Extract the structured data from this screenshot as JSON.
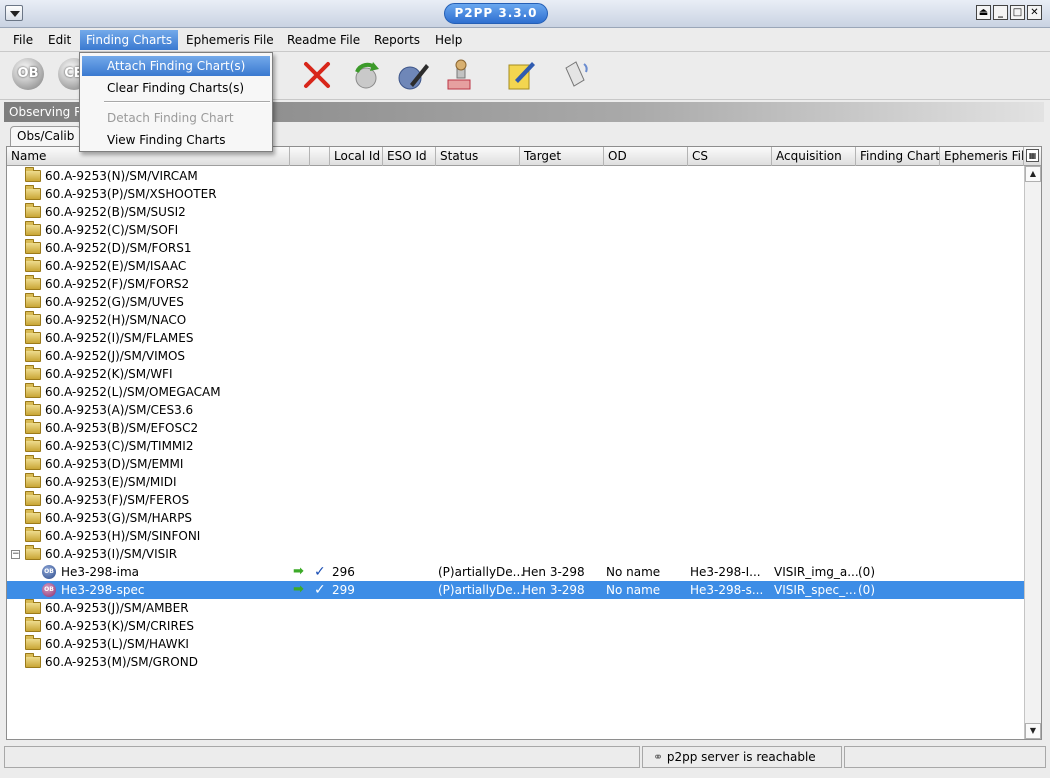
{
  "window": {
    "title": "P2PP 3.3.0"
  },
  "menubar": {
    "items": [
      {
        "label": "File",
        "mnemonic": "F"
      },
      {
        "label": "Edit",
        "mnemonic": "E"
      },
      {
        "label": "Finding Charts",
        "mnemonic": "C",
        "active": true
      },
      {
        "label": "Ephemeris File",
        "mnemonic": "p"
      },
      {
        "label": "Readme File",
        "mnemonic": "R"
      },
      {
        "label": "Reports",
        "mnemonic": "o"
      },
      {
        "label": "Help",
        "mnemonic": "H"
      }
    ]
  },
  "toolbar": {
    "buttons": [
      {
        "name": "ob-button",
        "label": "OB"
      },
      {
        "name": "ca-button",
        "label": "CB"
      },
      {
        "name": "delete-button",
        "icon": "red-x-icon"
      },
      {
        "name": "refresh-button",
        "icon": "green-circular-arrow-icon"
      },
      {
        "name": "edit-ob-button",
        "icon": "ob-pencil-icon"
      },
      {
        "name": "stamp-button",
        "icon": "stamp-icon"
      },
      {
        "name": "note-button",
        "icon": "clipboard-pencil-icon"
      },
      {
        "name": "check-in-button",
        "icon": "usb-transfer-icon"
      }
    ]
  },
  "dropdown": {
    "items": [
      {
        "label": "Attach Finding Chart(s)",
        "state": "hover"
      },
      {
        "label": "Clear Finding Charts(s)",
        "state": "normal"
      },
      {
        "label": "Detach Finding Chart",
        "state": "disabled"
      },
      {
        "label": "View Finding Charts",
        "state": "normal"
      }
    ]
  },
  "observing_runs_label": "Observing Runs",
  "tabs": [
    {
      "label": "Obs/Calib"
    }
  ],
  "table": {
    "columns": [
      "Name",
      "",
      "",
      "Local Id",
      "ESO Id",
      "Status",
      "Target",
      "OD",
      "CS",
      "Acquisition",
      "Finding Charts",
      "Ephemeris File"
    ],
    "folders_top": [
      "60.A-9253(N)/SM/VIRCAM",
      "60.A-9253(P)/SM/XSHOOTER",
      "60.A-9252(B)/SM/SUSI2",
      "60.A-9252(C)/SM/SOFI",
      "60.A-9252(D)/SM/FORS1",
      "60.A-9252(E)/SM/ISAAC",
      "60.A-9252(F)/SM/FORS2",
      "60.A-9252(G)/SM/UVES",
      "60.A-9252(H)/SM/NACO",
      "60.A-9252(I)/SM/FLAMES",
      "60.A-9252(J)/SM/VIMOS",
      "60.A-9252(K)/SM/WFI",
      "60.A-9252(L)/SM/OMEGACAM",
      "60.A-9253(A)/SM/CES3.6",
      "60.A-9253(B)/SM/EFOSC2",
      "60.A-9253(C)/SM/TIMMI2",
      "60.A-9253(D)/SM/EMMI",
      "60.A-9253(E)/SM/MIDI",
      "60.A-9253(F)/SM/FEROS",
      "60.A-9253(G)/SM/HARPS",
      "60.A-9253(H)/SM/SINFONI"
    ],
    "expanded_folder": "60.A-9253(I)/SM/VISIR",
    "obs": [
      {
        "name": "He3-298-ima",
        "local_id": "296",
        "status": "(P)artiallyDe...",
        "target": "Hen 3-298",
        "od": "No name",
        "cs": "He3-298-I...",
        "acquisition": "VISIR_img_a...",
        "finding_charts": "(0)",
        "selected": false
      },
      {
        "name": "He3-298-spec",
        "local_id": "299",
        "status": "(P)artiallyDe...",
        "target": "Hen 3-298",
        "od": "No name",
        "cs": "He3-298-s...",
        "acquisition": "VISIR_spec_...",
        "finding_charts": "(0)",
        "selected": true
      }
    ],
    "folders_bottom": [
      "60.A-9253(J)/SM/AMBER",
      "60.A-9253(K)/SM/CRIRES",
      "60.A-9253(L)/SM/HAWKI",
      "60.A-9253(M)/SM/GROND"
    ]
  },
  "statusbar": {
    "message": "p2pp server is reachable"
  }
}
